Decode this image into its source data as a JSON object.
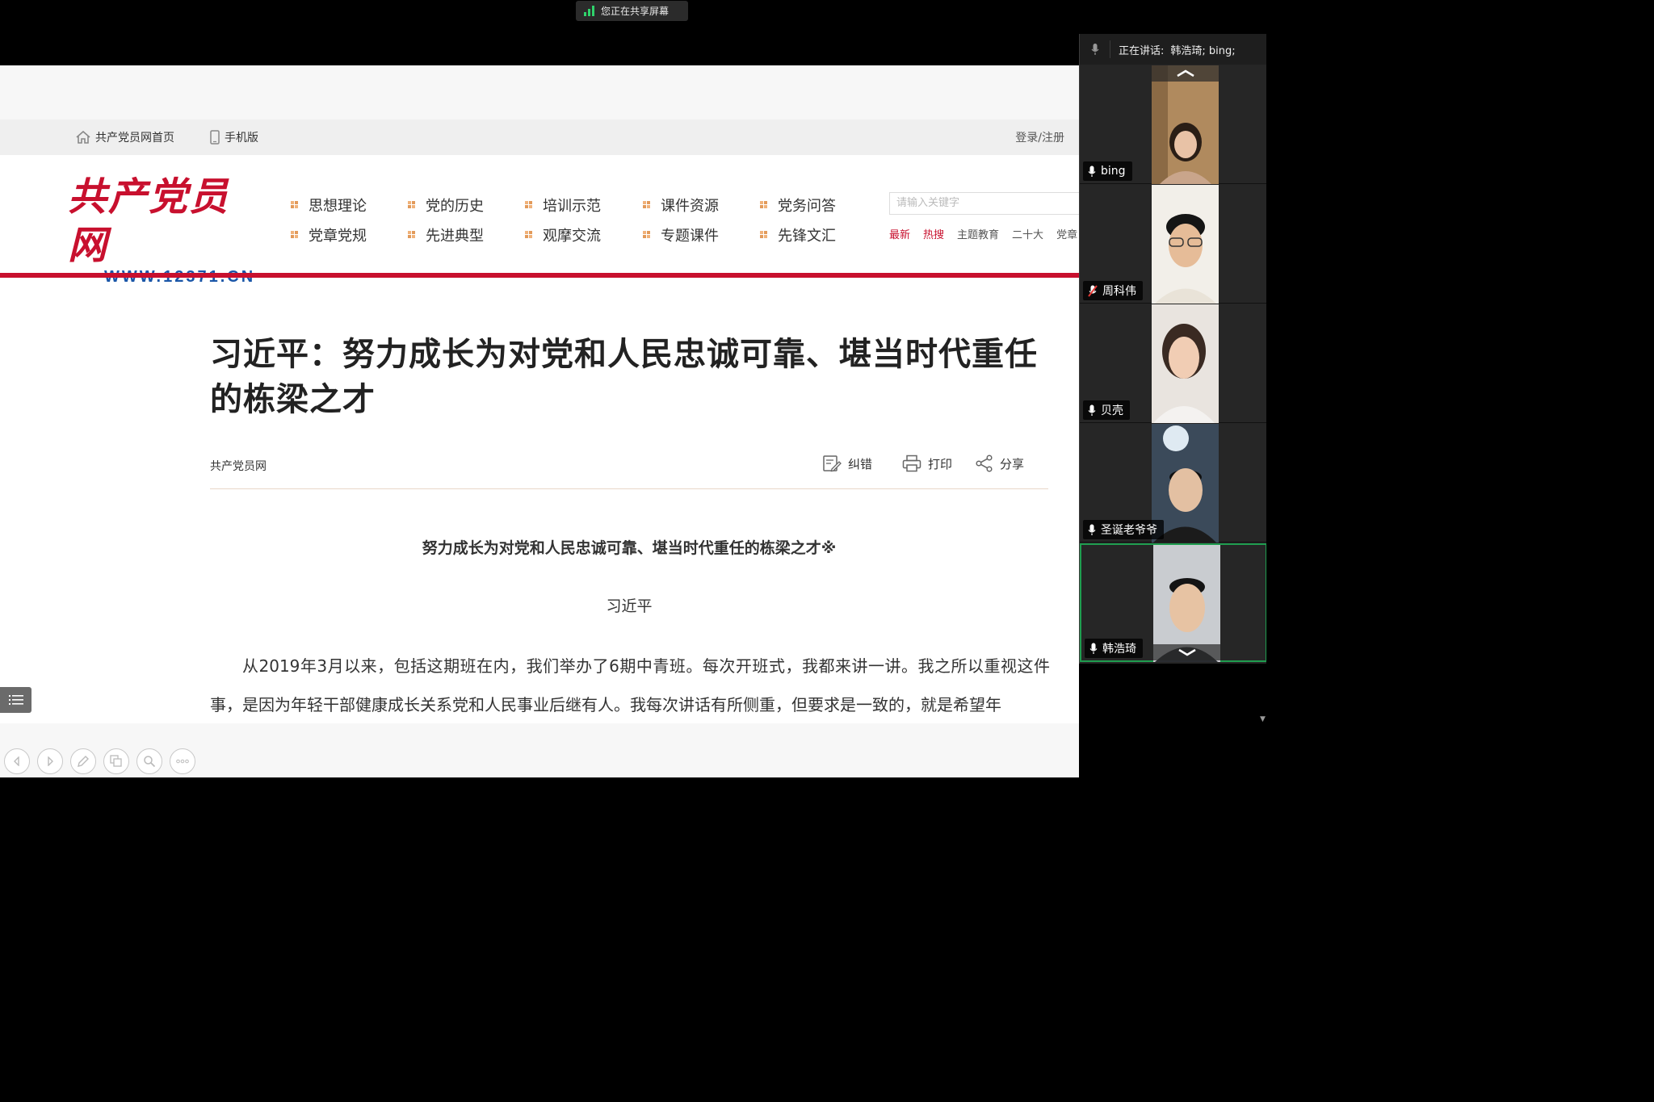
{
  "share_banner": {
    "label": "您正在共享屏幕"
  },
  "colors": {
    "brand_red": "#c8102e",
    "logo_blue": "#1a56a8",
    "share_green": "#2fd36b",
    "active_tile_border": "#1f9d4f"
  },
  "site": {
    "topbar": {
      "home": "共产党员网首页",
      "mobile": "手机版",
      "login": "登录/注册"
    },
    "logo": {
      "title": "共产党员网",
      "url": "WWW.12371.CN"
    },
    "nav_row1": [
      "思想理论",
      "党的历史",
      "培训示范",
      "课件资源",
      "党务问答"
    ],
    "nav_row2": [
      "党章党规",
      "先进典型",
      "观摩交流",
      "专题课件",
      "先锋文汇"
    ],
    "search_placeholder": "请输入关键字",
    "hot_links": [
      "最新",
      "热搜",
      "主题教育",
      "二十大",
      "党章"
    ]
  },
  "article": {
    "title": "习近平：努力成长为对党和人民忠诚可靠、堪当时代重任的栋梁之才",
    "source": "共产党员网",
    "actions": {
      "correct": "纠错",
      "print": "打印",
      "share": "分享"
    },
    "subtitle": "努力成长为对党和人民忠诚可靠、堪当时代重任的栋梁之才※",
    "author": "习近平",
    "paragraph": "从2019年3月以来，包括这期班在内，我们举办了6期中青班。每次开班式，我都来讲一讲。我之所以重视这件事，是因为年轻干部健康成长关系党和人民事业后继有人。我每次讲话有所侧重，但要求是一致的，就是希望年"
  },
  "viewer_toolbar": [
    "prev-icon",
    "next-icon",
    "pen-icon",
    "thumbnails-icon",
    "zoom-icon",
    "more-icon"
  ],
  "meeting": {
    "speaking_label": "正在讲话:",
    "speaking_names": "韩浩琦; bing;",
    "participants": [
      {
        "name": "bing",
        "mic": "on",
        "active": false
      },
      {
        "name": "周科伟",
        "mic": "muted",
        "active": false
      },
      {
        "name": "贝壳",
        "mic": "on",
        "active": false
      },
      {
        "name": "圣诞老爷爷",
        "mic": "on",
        "active": false
      },
      {
        "name": "韩浩琦",
        "mic": "on",
        "active": true
      }
    ]
  }
}
